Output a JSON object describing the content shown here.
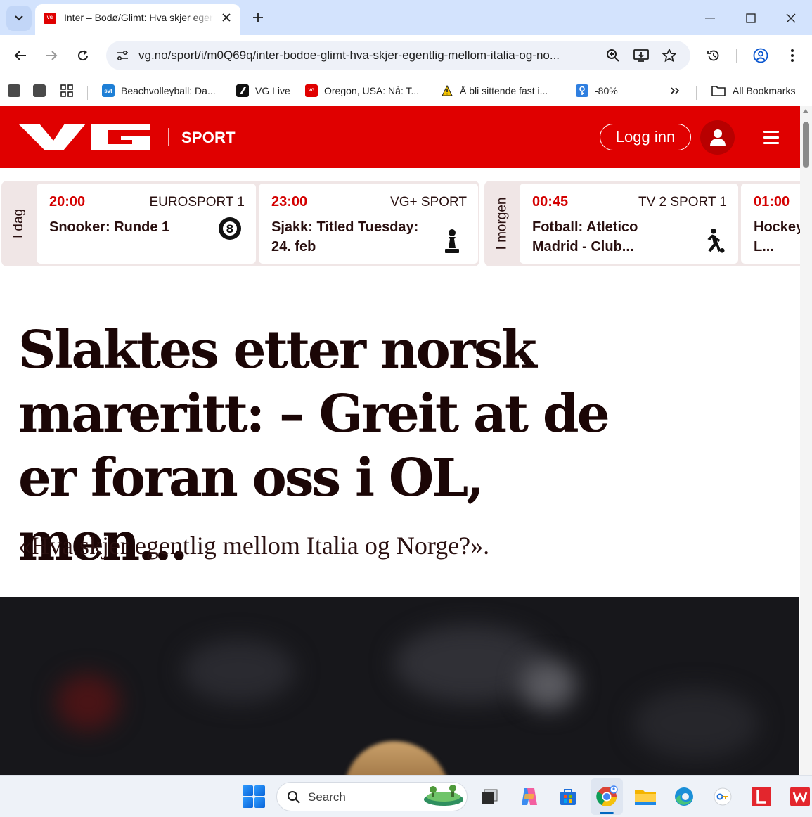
{
  "browser": {
    "tab_title": "Inter – Bodø/Glimt: Hva skjer egentlig mellom Italia og Norge?",
    "tab_favicon_text": "VG",
    "url": "vg.no/sport/i/m0Q69q/inter-bodoe-glimt-hva-skjer-egentlig-mellom-italia-og-no...",
    "bookmarks": [
      {
        "label": "Beachvolleyball: Da...",
        "icon": "svt-icon",
        "icon_text": "svt",
        "color": "#1e7fd6"
      },
      {
        "label": "VG Live",
        "icon": "vg-live-icon",
        "icon_text": "",
        "color": "#111111"
      },
      {
        "label": "Oregon, USA: Nå: T...",
        "icon": "vg-icon",
        "icon_text": "VG",
        "color": "#e00000"
      },
      {
        "label": "Å bli sittende fast i...",
        "icon": "warning-icon",
        "icon_text": "",
        "color": "#f2c200"
      },
      {
        "label": "-80%",
        "icon": "keyhole-icon",
        "icon_text": "",
        "color": "#2f7fe0"
      }
    ],
    "all_bookmarks_label": "All Bookmarks"
  },
  "vg": {
    "section": "SPORT",
    "login_label": "Logg inn",
    "brand_red": "#e00000"
  },
  "tv_guide": {
    "today_label": "I dag",
    "tomorrow_label": "I morgen",
    "today": [
      {
        "time": "20:00",
        "channel": "EUROSPORT 1",
        "title": "Snooker: Runde 1",
        "icon": "snooker-ball-icon"
      },
      {
        "time": "23:00",
        "channel": "VG+ SPORT",
        "title": "Sjakk: Titled Tuesday: 24. feb",
        "icon": "chess-pawn-icon"
      }
    ],
    "tomorrow": [
      {
        "time": "00:45",
        "channel": "TV 2 SPORT 1",
        "title": "Fotball: Atletico Madrid - Club...",
        "icon": "football-player-icon"
      },
      {
        "time": "01:00",
        "channel": "",
        "title": "Hockey: HC - L...",
        "icon": ""
      }
    ]
  },
  "article": {
    "headline": "Slaktes etter norsk mareritt: – Greit at de er foran oss i OL, men...",
    "subtitle": "«Hva skjer egentlig mellom Italia og Norge?»."
  },
  "taskbar": {
    "search_label": "Search"
  }
}
